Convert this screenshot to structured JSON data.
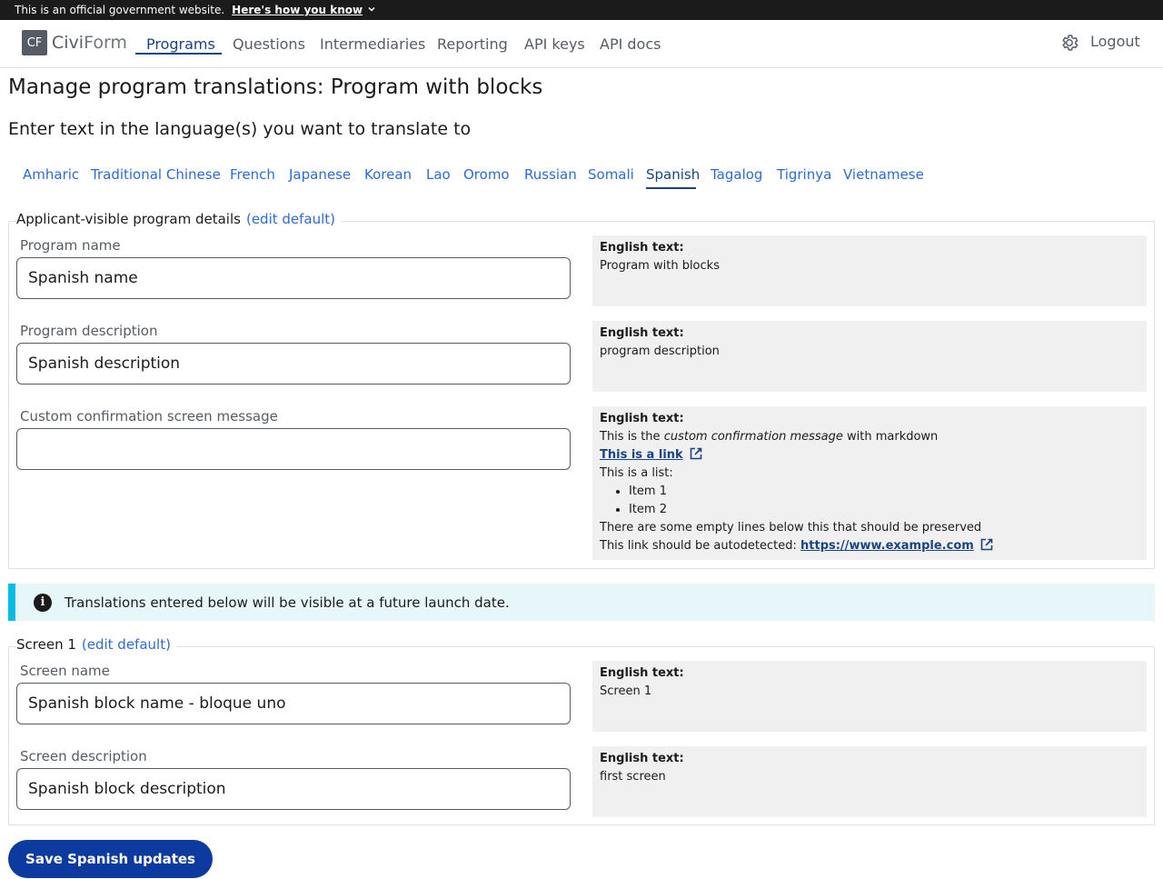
{
  "gov_banner": {
    "text": "This is an official government website.",
    "how_link": "Here's how you know"
  },
  "nav": {
    "logo_mark": "CF",
    "logo_civi": "Civi",
    "logo_form": "Form",
    "items": [
      "Programs",
      "Questions",
      "Intermediaries",
      "Reporting",
      "API keys",
      "API docs"
    ],
    "active_item": "Programs",
    "logout": "Logout"
  },
  "page": {
    "title": "Manage program translations: Program with blocks",
    "subtitle": "Enter text in the language(s) you want to translate to"
  },
  "languages": [
    "Amharic",
    "Traditional Chinese",
    "French",
    "Japanese",
    "Korean",
    "Lao",
    "Oromo",
    "Russian",
    "Somali",
    "Spanish",
    "Tagalog",
    "Tigrinya",
    "Vietnamese"
  ],
  "active_language": "Spanish",
  "program_details": {
    "legend": "Applicant-visible program details",
    "edit_default": "(edit default)",
    "english_heading": "English text:",
    "fields": [
      {
        "label": "Program name",
        "value": "Spanish name",
        "english": "Program with blocks"
      },
      {
        "label": "Program description",
        "value": "Spanish description",
        "english": "program description"
      },
      {
        "label": "Custom confirmation screen message",
        "value": ""
      }
    ],
    "confirmation_english": {
      "line1_before": "This is the ",
      "line1_italic": "custom confirmation message",
      "line1_after": " with markdown",
      "link_text": "This is a link",
      "list_intro": "This is a list:",
      "list_items": [
        "Item 1",
        "Item 2"
      ],
      "empty_lines_note": "There are some empty lines below this that should be preserved",
      "autodetect_before": "This link should be autodetected: ",
      "autodetect_url": "https://www.example.com"
    }
  },
  "alert": {
    "icon": "info-icon",
    "text": "Translations entered below will be visible at a future launch date."
  },
  "screen1": {
    "legend": "Screen 1",
    "edit_default": "(edit default)",
    "english_heading": "English text:",
    "fields": [
      {
        "label": "Screen name",
        "value": "Spanish block name - bloque uno",
        "english": "Screen 1"
      },
      {
        "label": "Screen description",
        "value": "Spanish block description",
        "english": "first screen"
      }
    ]
  },
  "save_button": "Save Spanish updates",
  "colors": {
    "link": "#2e6ad0",
    "active_nav": "#1a4480",
    "primary_button": "#0d3a9e",
    "alert_bg": "#e7f6f8",
    "alert_border": "#00bde3",
    "english_bg": "#f0f0f0"
  }
}
